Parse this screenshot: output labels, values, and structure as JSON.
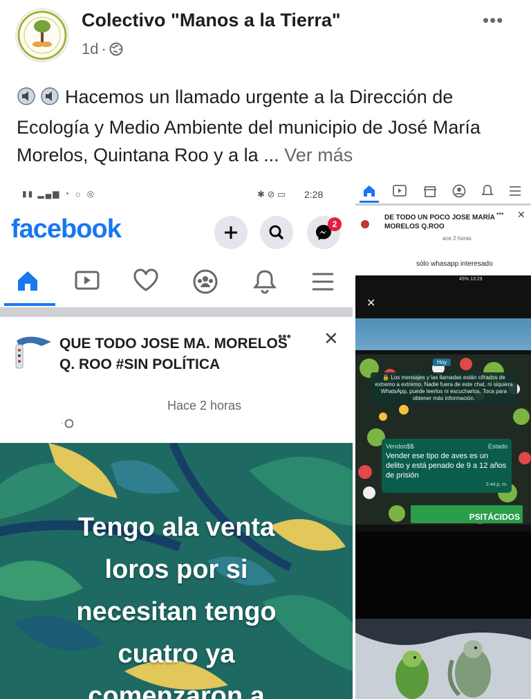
{
  "header": {
    "page_name": "Colectivo \"Manos a la Tierra\"",
    "time": "1d",
    "separator": "·",
    "more": "•••"
  },
  "post": {
    "text": "Hacemos un llamado urgente a la Dirección de Ecología y Medio Ambiente del municipio de José María Morelos, Quintana Roo y a la ...",
    "see_more": "Ver más"
  },
  "left_shot": {
    "status_time": "2:28",
    "logo": "facebook",
    "messenger_badge": "2",
    "nav_icons": [
      "home-icon",
      "video-icon",
      "dating-heart-icon",
      "groups-icon",
      "bell-icon",
      "menu-icon"
    ],
    "group_name": "QUE TODO JOSE MA. MORELOS Q. ROO  #SIN POLÍTICA",
    "posted": "Hace 2 horas",
    "more": "•••",
    "close": "✕",
    "overlay_text": [
      "Tengo ala venta",
      "loros por si",
      "necesitan tengo",
      "cuatro ya",
      "comenzaron a"
    ]
  },
  "right_shot": {
    "group_name": "DE TODO UN POCO JOSE MARÍA MORELOS Q.ROO",
    "posted": "ace 2 horas",
    "more": "•••",
    "close": "✕",
    "comment": "sólo whasapp interesado",
    "inner_status": "45%  13:29",
    "close_x": "✕",
    "day_chip": "Hoy",
    "encryption": "🔒 Los mensajes y las llamadas están cifrados de extremo a extremo. Nadie fuera de este chat, ni siquiera WhatsApp, puede leerlos ni escucharlos. Toca para obtener más información.",
    "status_label": "Estado",
    "sender": "Vendoo$$",
    "message": "Vender ese tipo de aves es un delito y está penado de 9 a 12 años de prisión",
    "message_time": "2:44 p. m.",
    "banner": "PSITÁCIDOS"
  }
}
